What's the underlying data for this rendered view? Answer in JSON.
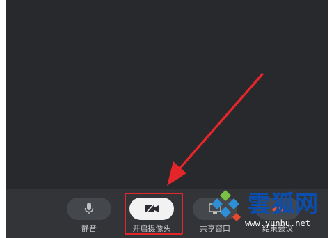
{
  "toolbar": {
    "mute_label": "静音",
    "camera_label": "开启摄像头",
    "share_label": "共享窗口",
    "end_label": "结束会议"
  },
  "watermark": {
    "title": "雲狐网",
    "url": "www.yunhu.net"
  },
  "colors": {
    "video_bg": "#27292d",
    "toolbar_bg": "#323438",
    "highlight": "#e4262b",
    "arrow": "#e4262b",
    "watermark_text": "#0a4fb0"
  },
  "icons": {
    "mute": "microphone-icon",
    "camera": "camera-off-icon",
    "share": "share-window-icon",
    "end": "end-meeting-icon"
  }
}
